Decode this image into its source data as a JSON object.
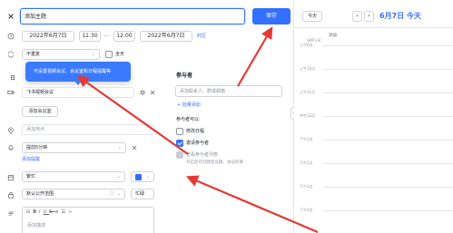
{
  "header": {
    "close_icon": "close-icon",
    "title_value": "添加主题",
    "save_label": "保存"
  },
  "time": {
    "start_date": "2022年6月7日",
    "start_time": "11:30",
    "separator": "—",
    "end_time": "12:00",
    "end_date": "2022年6月7日",
    "timezone_label": "时区",
    "repeat_value": "不重复",
    "allday_label": "全天"
  },
  "tooltip": {
    "text": "可设置视频会议、会议室和日程提醒等"
  },
  "form": {
    "section_letter": "日",
    "video_meeting": "飞书视频会议",
    "add_room_label": "添加会议室",
    "location_placeholder": "添加地点",
    "reminder_value": "提前5分钟",
    "add_reminder_link": "添加提醒",
    "busy_value": "繁忙",
    "visibility_value": "默认公开范围",
    "priority_value": "忙碌",
    "description_placeholder": "添加描述"
  },
  "participants": {
    "title": "参与者",
    "input_placeholder": "添加联系人、群或邮箱",
    "add_link": "+ 批量添加",
    "permissions_title": "参与者可以:",
    "perm_edit": "修改日程",
    "perm_invite": "邀请参与者",
    "perm_view": "查看参与者列表",
    "perm_note": "开启后可创建会议群、会议纪要"
  },
  "calendar": {
    "today_button": "今天",
    "date_title": "6月7日 今天",
    "timezone": "GMT+8",
    "event_label": "添加",
    "hours": [
      "上午9点",
      "上午10点",
      "上午11点",
      "中午12点",
      "下午1点",
      "下午2点",
      "下午3点",
      "下午4点"
    ]
  },
  "colors": {
    "primary": "#3370ff",
    "tooltip_bg": "#3a7afe",
    "arrow_red": "#e53935"
  }
}
